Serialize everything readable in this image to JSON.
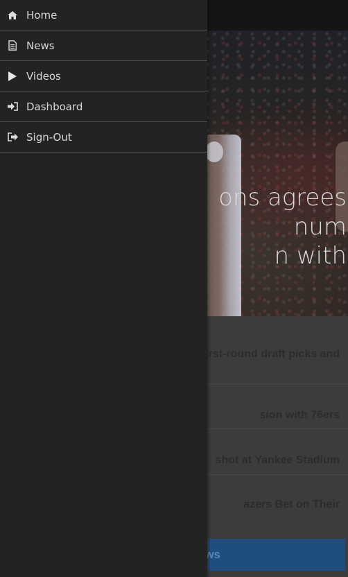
{
  "drawer": {
    "items": [
      {
        "label": "Home",
        "icon": "home-icon"
      },
      {
        "label": "News",
        "icon": "document-icon"
      },
      {
        "label": "Videos",
        "icon": "play-icon"
      },
      {
        "label": "Dashboard",
        "icon": "sign-in-icon"
      },
      {
        "label": "Sign-Out",
        "icon": "sign-out-icon"
      }
    ]
  },
  "hero": {
    "title_visible": "ons agrees\nnum\nn with"
  },
  "news": {
    "items": [
      {
        "text": "first-round draft picks and"
      },
      {
        "text": "sion with 76ers"
      },
      {
        "text": "shot at Yankee Stadium"
      },
      {
        "text": "azers Bet on Their"
      }
    ],
    "more_button": "ws"
  },
  "colors": {
    "drawer_bg": "#232323",
    "topbar_bg": "#151515",
    "button_blue": "#1f4d7e"
  }
}
